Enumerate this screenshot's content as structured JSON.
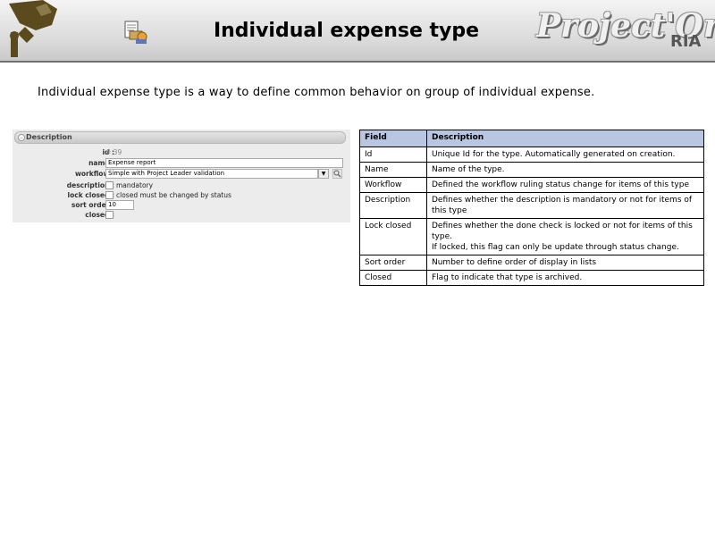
{
  "header": {
    "title": "Individual expense type",
    "logo_text": "Project'Or",
    "logo_sub": "RIA"
  },
  "intro": "Individual expense type is a way to define common behavior on group of individual expense.",
  "form": {
    "section_title": "Description",
    "fields": {
      "id": {
        "label": "id :",
        "value": "# 39"
      },
      "name": {
        "label": "name :",
        "value": "Expense report"
      },
      "workflow": {
        "label": "workflow :",
        "value": "Simple with Project Leader validation"
      },
      "description": {
        "label": "description :",
        "checkbox_label": "mandatory"
      },
      "lock_closed": {
        "label": "lock closed :",
        "checkbox_label": "closed must be changed by status"
      },
      "sort_order": {
        "label": "sort order :",
        "value": "10"
      },
      "closed": {
        "label": "closed :"
      }
    }
  },
  "table": {
    "headers": [
      "Field",
      "Description"
    ],
    "rows": [
      {
        "field": "Id",
        "desc": [
          "Unique Id for the type. Automatically generated on creation."
        ]
      },
      {
        "field": "Name",
        "desc": [
          "Name of the type."
        ]
      },
      {
        "field": "Workflow",
        "desc": [
          "Defined the workflow ruling status change for items of this type"
        ]
      },
      {
        "field": "Description",
        "desc": [
          "Defines whether the description is mandatory or not for items of this type"
        ]
      },
      {
        "field": "Lock closed",
        "desc": [
          "Defines whether the done check is locked or not for items of this type.",
          "If locked, this flag can only be update through status change."
        ]
      },
      {
        "field": "Sort order",
        "desc": [
          "Number to define order of display in lists"
        ]
      },
      {
        "field": "Closed",
        "desc": [
          "Flag to indicate that type is archived."
        ]
      }
    ]
  },
  "colors": {
    "table_header_bg": "#b8c6e2",
    "panel_bg": "#ececec",
    "header_border": "#6f6f6f"
  }
}
